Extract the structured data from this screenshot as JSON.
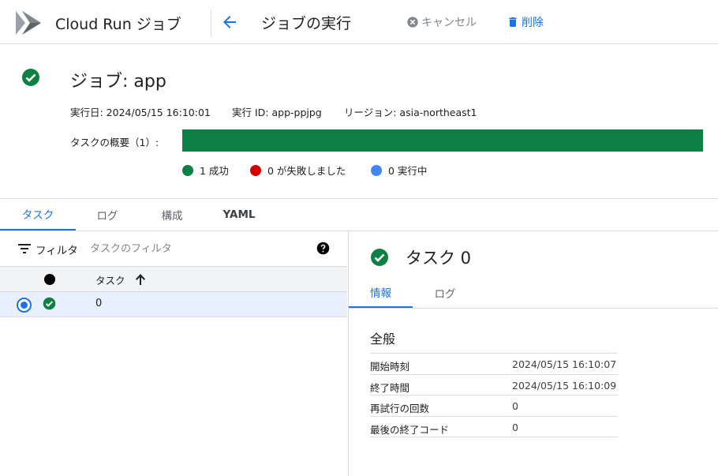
{
  "header": {
    "product_title": "Cloud Run ジョブ",
    "page_title": "ジョブの実行",
    "cancel_label": "キャンセル",
    "delete_label": "削除",
    "accent_color": "#1a73e8"
  },
  "job": {
    "title": "ジョブ: app",
    "status": "success",
    "executed_at": "実行日: 2024/05/15 16:10:01",
    "execution_id": "実行 ID: app-ppjpg",
    "region": "リージョン: asia-northeast1",
    "summary_label": "タスクの概要（1）:",
    "progress_success_fraction": 1.0,
    "legend": {
      "success": "1 成功",
      "failed": "0 が失敗しました",
      "running": "0 実行中"
    },
    "colors": {
      "success": "#0d8043",
      "failed": "#d50000",
      "running": "#4285f4"
    }
  },
  "tabs": [
    "タスク",
    "ログ",
    "構成",
    "YAML"
  ],
  "active_tab": "タスク",
  "task_list": {
    "filter_label": "フィルタ",
    "filter_placeholder": "タスクのフィルタ",
    "column_task": "タスク",
    "sort": "ascending",
    "rows": [
      {
        "task": "0",
        "status": "success",
        "selected": true
      }
    ]
  },
  "detail": {
    "title": "タスク 0",
    "tabs": [
      "情報",
      "ログ"
    ],
    "active_tab": "情報",
    "section_title": "全般",
    "rows": [
      {
        "key": "開始時刻",
        "value": "2024/05/15 16:10:07"
      },
      {
        "key": "終了時間",
        "value": "2024/05/15 16:10:09"
      },
      {
        "key": "再試行の回数",
        "value": "0"
      },
      {
        "key": "最後の終了コード",
        "value": "0"
      }
    ]
  }
}
